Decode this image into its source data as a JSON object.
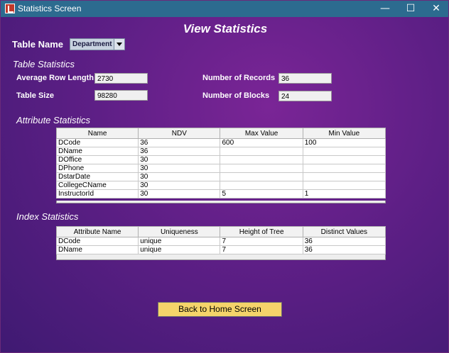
{
  "window": {
    "title": "Statistics Screen",
    "minimize": "—",
    "maximize": "☐",
    "close": "✕"
  },
  "heading": "View Statistics",
  "table_name": {
    "label": "Table Name",
    "selected": "Department"
  },
  "table_stats": {
    "section": "Table Statistics",
    "avg_row_length_label": "Average Row Length",
    "avg_row_length": "2730",
    "table_size_label": "Table Size",
    "table_size": "98280",
    "num_records_label": "Number of Records",
    "num_records": "36",
    "num_blocks_label": "Number of Blocks",
    "num_blocks": "24"
  },
  "attribute_stats": {
    "section": "Attribute Statistics",
    "columns": [
      "Name",
      "NDV",
      "Max Value",
      "Min Value"
    ],
    "rows": [
      [
        "DCode",
        "36",
        "600",
        "100"
      ],
      [
        "DName",
        "36",
        "",
        ""
      ],
      [
        "DOffice",
        "30",
        "",
        ""
      ],
      [
        "DPhone",
        "30",
        "",
        ""
      ],
      [
        "DstarDate",
        "30",
        "",
        ""
      ],
      [
        "CollegeCName",
        "30",
        "",
        ""
      ],
      [
        "InstructorId",
        "30",
        "5",
        "1"
      ]
    ]
  },
  "index_stats": {
    "section": "Index Statistics",
    "columns": [
      "Attribute Name",
      "Uniqueness",
      "Height of Tree",
      "Distinct Values"
    ],
    "rows": [
      [
        "DCode",
        "unique",
        "7",
        "36"
      ],
      [
        "DName",
        "unique",
        "7",
        "36"
      ]
    ]
  },
  "home_button": "Back to Home Screen"
}
